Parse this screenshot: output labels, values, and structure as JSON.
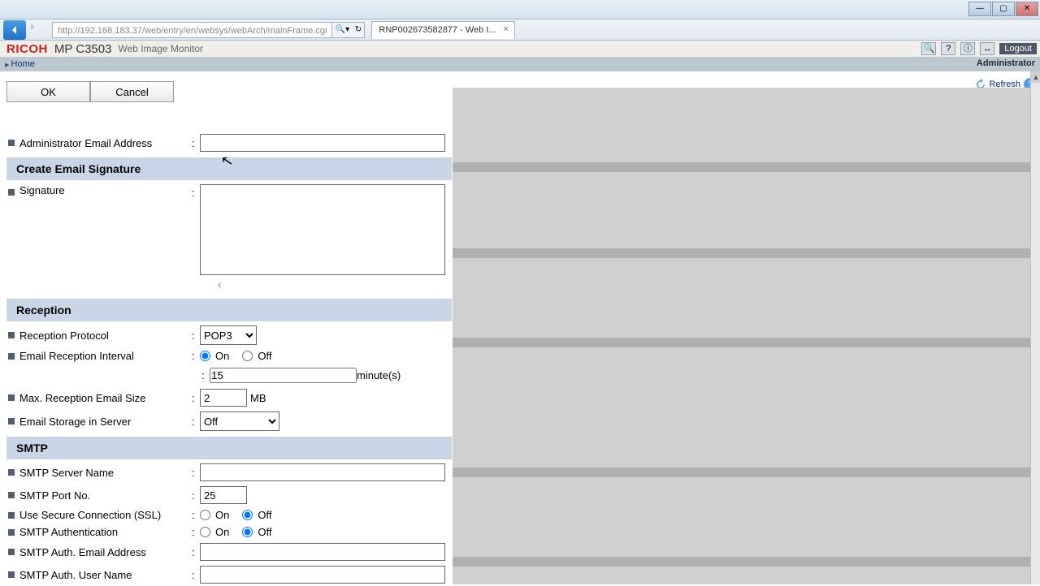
{
  "window": {
    "url": "http://192.168.183.37/web/entry/en/websys/webArch/mainFrame.cgi",
    "tab_title": "RNP002673582877 - Web I..."
  },
  "brand": {
    "logo": "RICOH",
    "model": "MP C3503",
    "app": "Web Image Monitor"
  },
  "nav": {
    "home": "Home",
    "logout": "Logout",
    "user": "Administrator"
  },
  "tools": {
    "refresh": "Refresh"
  },
  "buttons": {
    "ok": "OK",
    "cancel": "Cancel"
  },
  "labels": {
    "admin_email": "Administrator Email Address",
    "signature": "Signature",
    "reception_protocol": "Reception Protocol",
    "email_interval": "Email Reception Interval",
    "max_size": "Max. Reception Email Size",
    "storage": "Email Storage in Server",
    "smtp_server": "SMTP Server Name",
    "smtp_port": "SMTP Port No.",
    "ssl": "Use Secure Connection (SSL)",
    "smtp_auth": "SMTP Authentication",
    "smtp_auth_email": "SMTP Auth. Email Address",
    "smtp_auth_user": "SMTP Auth. User Name"
  },
  "sections": {
    "signature": "Create Email Signature",
    "reception": "Reception",
    "smtp": "SMTP"
  },
  "values": {
    "admin_email": "",
    "signature": "",
    "protocol": "POP3",
    "interval_on": true,
    "interval_minutes": "15",
    "minutes_suffix": "minute(s)",
    "max_size": "2",
    "mb": "MB",
    "storage": "Off",
    "smtp_server": "",
    "smtp_port": "25",
    "ssl_on": false,
    "auth_on": false,
    "auth_email": "",
    "auth_user": ""
  },
  "radio": {
    "on": "On",
    "off": "Off"
  }
}
